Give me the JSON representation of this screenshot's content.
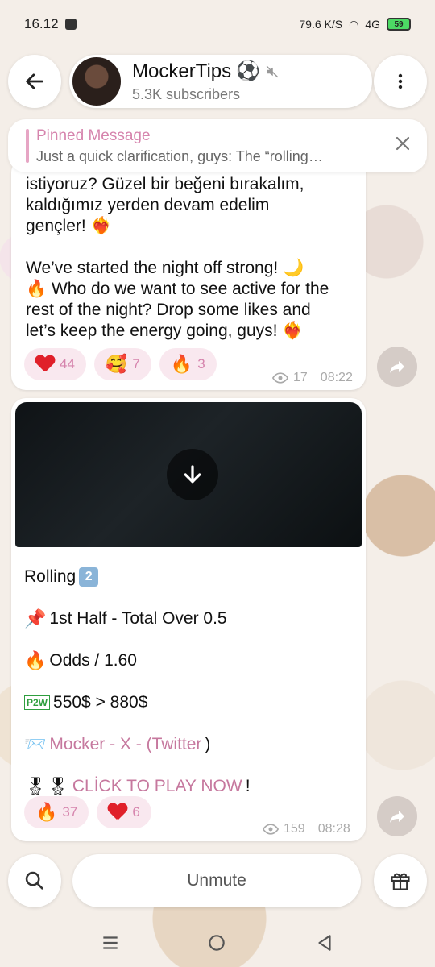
{
  "status": {
    "time": "16.12",
    "network_speed": "79.6 K/S",
    "network_type": "4G",
    "battery": "59"
  },
  "header": {
    "channel_name": "MockerTips",
    "channel_emoji": "⚽",
    "subscribers": "5.3K subscribers"
  },
  "pinned": {
    "title": "Pinned Message",
    "text": "Just a quick clarification, guys:  The “rolling…"
  },
  "message1": {
    "text": "istiyoruz? Güzel bir beğeni bırakalım,\nkaldığımız yerden devam edelim\ngençler! ❤️‍🔥\n\nWe’ve started the night off strong! 🌙\n🔥 Who do we want to see active for the\nrest of the night? Drop some likes and\nlet’s keep the energy going, guys! ❤️‍🔥",
    "reactions": [
      {
        "emoji": "heart",
        "count": "44"
      },
      {
        "emoji": "🥰",
        "count": "7"
      },
      {
        "emoji": "🔥",
        "count": "3"
      }
    ],
    "views": "17",
    "time": "08:22"
  },
  "message2": {
    "line1_text": "Rolling",
    "line1_badge": "2",
    "line2_emoji": "📌",
    "line2_text": "1st Half - Total Over 0.5",
    "line3_emoji": "🔥",
    "line3_text": "Odds / 1.60",
    "line4_badge": "P2W",
    "line4_text": "550$ > 880$",
    "line5_emoji": "📨",
    "line5_link": "Mocker - X - (Twitter",
    "line5_tail": ")",
    "line6_emoji": "🎖🎖",
    "line6_link": "CLİCK TO PLAY NOW",
    "line6_tail": "!",
    "reactions": [
      {
        "emoji": "🔥",
        "count": "37"
      },
      {
        "emoji": "heart",
        "count": "6"
      }
    ],
    "views": "159",
    "time": "08:28"
  },
  "bottom": {
    "unmute_label": "Unmute"
  },
  "icons": {
    "back": "arrow-left-icon",
    "more": "more-vertical-icon",
    "close": "close-icon",
    "download": "arrow-down-icon",
    "forward": "share-icon",
    "search": "search-icon",
    "gift": "gift-icon",
    "eye": "eye-icon",
    "mute": "mute-icon"
  },
  "colors": {
    "accent": "#d684ad",
    "link": "#c6789e",
    "reaction_bg": "#f9e8ef"
  }
}
